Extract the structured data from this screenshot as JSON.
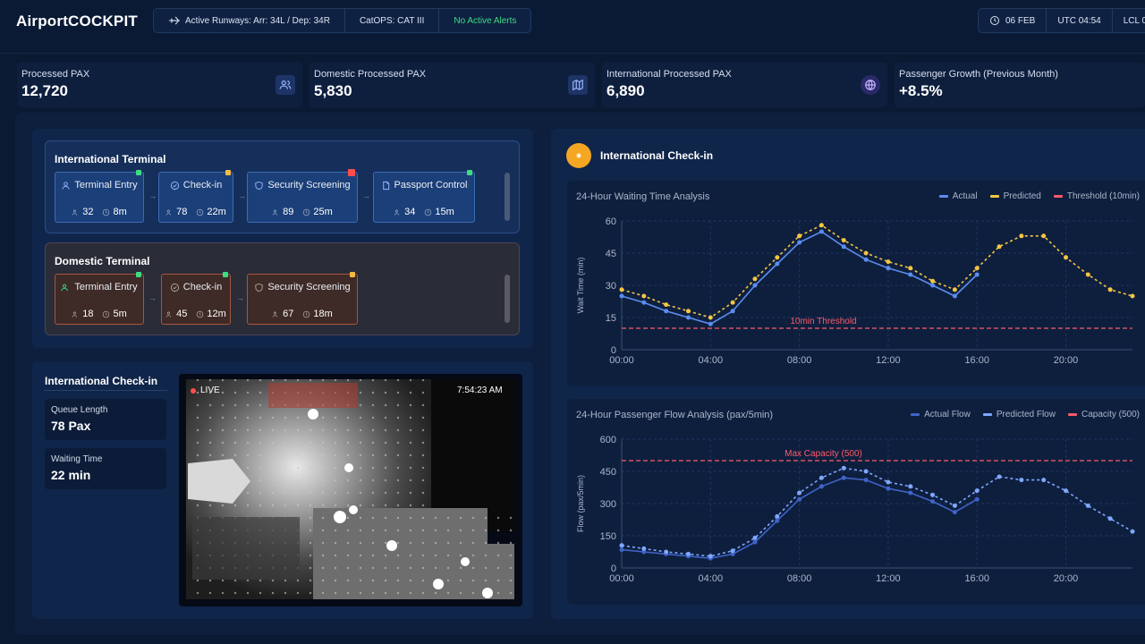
{
  "header": {
    "app_title": "AirportCOCKPIT",
    "runways": "Active Runways: Arr: 34L / Dep: 34R",
    "catops": "CatOPS: CAT III",
    "alerts": "No Active Alerts",
    "date": "06 FEB",
    "utc": "UTC 04:54",
    "lcl": "LCL 0"
  },
  "kpis": [
    {
      "label": "Processed PAX",
      "value": "12,720",
      "icon": "users-icon"
    },
    {
      "label": "Domestic Processed PAX",
      "value": "5,830",
      "icon": "map-icon"
    },
    {
      "label": "International Processed PAX",
      "value": "6,890",
      "icon": "globe-icon"
    },
    {
      "label": "Passenger Growth (Previous Month)",
      "value": "+8.5%"
    }
  ],
  "international_terminal": {
    "title": "International Terminal",
    "stages": [
      {
        "name": "Terminal Entry",
        "pax": "32",
        "time": "8m",
        "status": "green"
      },
      {
        "name": "Check-in",
        "pax": "78",
        "time": "22m",
        "status": "amber"
      },
      {
        "name": "Security Screening",
        "pax": "89",
        "time": "25m",
        "status": "red"
      },
      {
        "name": "Passport Control",
        "pax": "34",
        "time": "15m",
        "status": "green"
      }
    ]
  },
  "domestic_terminal": {
    "title": "Domestic Terminal",
    "stages": [
      {
        "name": "Terminal Entry",
        "pax": "18",
        "time": "5m",
        "status": "green"
      },
      {
        "name": "Check-in",
        "pax": "45",
        "time": "12m",
        "status": "green"
      },
      {
        "name": "Security Screening",
        "pax": "67",
        "time": "18m",
        "status": "amber"
      }
    ]
  },
  "checkin_panel": {
    "title": "International Check-in",
    "queue_length_label": "Queue Length",
    "queue_length_value": "78 Pax",
    "waiting_time_label": "Waiting Time",
    "waiting_time_value": "22 min",
    "camera_live": "LIVE",
    "camera_time": "7:54:23 AM"
  },
  "right_panel": {
    "title": "International Check-in"
  },
  "colors": {
    "actual": "#5b8def",
    "predicted": "#f5c542",
    "threshold": "#ff5a6a",
    "actual_flow": "#3f63c8",
    "predicted_flow": "#7fa8ff"
  },
  "chart_data": [
    {
      "type": "line",
      "title": "24-Hour Waiting Time Analysis",
      "xlabel": "",
      "ylabel": "Wait Time (min)",
      "ylim": [
        0,
        60
      ],
      "yticks": [
        "0",
        "15",
        "30",
        "45",
        "60"
      ],
      "xticks": [
        "00:00",
        "04:00",
        "08:00",
        "12:00",
        "16:00",
        "20:00"
      ],
      "x": [
        0,
        1,
        2,
        3,
        4,
        5,
        6,
        7,
        8,
        9,
        10,
        11,
        12,
        13,
        14,
        15,
        16,
        17,
        18,
        19,
        20,
        21,
        22,
        23
      ],
      "series": [
        {
          "name": "Actual",
          "values": [
            25,
            22,
            18,
            15,
            12,
            18,
            30,
            40,
            50,
            55,
            48,
            42,
            38,
            35,
            30,
            25,
            35,
            null,
            null,
            null,
            null,
            null,
            null,
            null
          ]
        },
        {
          "name": "Predicted",
          "values": [
            28,
            25,
            21,
            18,
            15,
            22,
            33,
            43,
            53,
            58,
            51,
            45,
            41,
            38,
            32,
            28,
            38,
            48,
            53,
            53,
            43,
            35,
            28,
            25
          ]
        }
      ],
      "threshold": {
        "name": "Threshold (10min)",
        "value": 10,
        "label": "10min Threshold"
      },
      "grid": true,
      "legend": "top-right"
    },
    {
      "type": "line",
      "title": "24-Hour Passenger Flow Analysis (pax/5min)",
      "xlabel": "",
      "ylabel": "Flow (pax/5min)",
      "ylim": [
        0,
        600
      ],
      "yticks": [
        "0",
        "150",
        "300",
        "450",
        "600"
      ],
      "xticks": [
        "00:00",
        "04:00",
        "08:00",
        "12:00",
        "16:00",
        "20:00"
      ],
      "x": [
        0,
        1,
        2,
        3,
        4,
        5,
        6,
        7,
        8,
        9,
        10,
        11,
        12,
        13,
        14,
        15,
        16,
        17,
        18,
        19,
        20,
        21,
        22,
        23
      ],
      "series": [
        {
          "name": "Actual Flow",
          "values": [
            85,
            75,
            65,
            55,
            45,
            65,
            120,
            220,
            320,
            380,
            420,
            410,
            370,
            350,
            310,
            260,
            320,
            null,
            null,
            null,
            null,
            null,
            null,
            null
          ]
        },
        {
          "name": "Predicted Flow",
          "values": [
            105,
            90,
            75,
            65,
            55,
            80,
            140,
            240,
            350,
            420,
            465,
            450,
            400,
            380,
            340,
            290,
            360,
            425,
            410,
            410,
            360,
            290,
            230,
            170
          ]
        }
      ],
      "threshold": {
        "name": "Capacity (500)",
        "value": 500,
        "label": "Max Capacity (500)"
      },
      "grid": true,
      "legend": "top-right"
    }
  ]
}
